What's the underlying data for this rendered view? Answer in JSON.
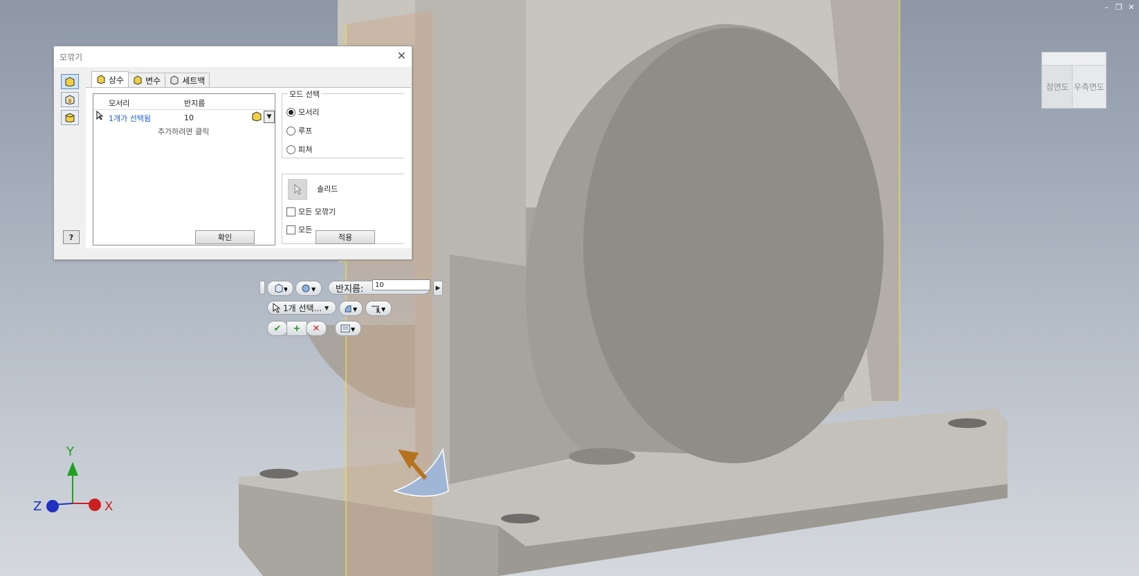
{
  "dialog": {
    "title": "모깎기",
    "tabs": [
      {
        "label": "상수"
      },
      {
        "label": "변수"
      },
      {
        "label": "세트백"
      }
    ],
    "grid": {
      "col_edge": "모서리",
      "col_radius": "반지름",
      "row_edge": "1개가 선택됨",
      "row_radius": "10",
      "add_hint": "추가하려면 클릭"
    },
    "mode_group": "모드 선택",
    "modes": [
      {
        "label": "모서리",
        "selected": true
      },
      {
        "label": "루프",
        "selected": false
      },
      {
        "label": "피쳐",
        "selected": false
      }
    ],
    "solid_label": "솔리드",
    "check_all_fillets": "모든 모깎기",
    "check_all_rounds": "모든",
    "ok_label": "확인",
    "apply_label": "적용"
  },
  "minitoolbar": {
    "radius_label": "반지름:",
    "radius_value": "10",
    "selection_label": "1개 선택..."
  },
  "viewcube": {
    "front": "정면도",
    "right": "우측면도"
  },
  "axes": {
    "x": "X",
    "y": "Y",
    "z": "Z"
  },
  "colors": {
    "background_top": "#8d97a6",
    "background_bottom": "#d5d9de",
    "part": "#c6c3bd",
    "highlight_plane": "#c9a98a",
    "selection_edge": "#f0e040",
    "x_axis": "#cc2020",
    "y_axis": "#20a020",
    "z_axis": "#2030c0",
    "link": "#1a5fd0"
  }
}
